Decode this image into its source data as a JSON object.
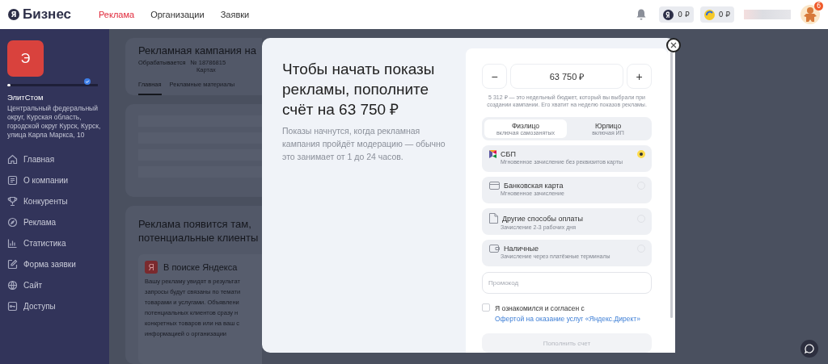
{
  "header": {
    "logo_mark": "Я",
    "logo_text": "Бизнес",
    "nav": [
      {
        "label": "Реклама",
        "selected": true
      },
      {
        "label": "Организации",
        "selected": false
      },
      {
        "label": "Заявки",
        "selected": false
      }
    ],
    "balances": [
      {
        "kind": "ya",
        "amount": "0 ₽"
      },
      {
        "kind": "coin",
        "amount": "0 ₽"
      }
    ],
    "avatar_badge": "6"
  },
  "sidebar": {
    "avatar_letter": "Э",
    "level": 0.02,
    "verified": true,
    "company": "ЭлитСтом",
    "address": "Центральный федеральный округ, Курская область, городской округ Курск, Курск, улица Карла Маркса, 10",
    "items": [
      {
        "kind": "home",
        "label": "Главная"
      },
      {
        "kind": "doc",
        "label": "О компании"
      },
      {
        "kind": "trophy",
        "label": "Конкуренты"
      },
      {
        "kind": "compass",
        "label": "Реклама"
      },
      {
        "kind": "chart",
        "label": "Статистика"
      },
      {
        "kind": "edit",
        "label": "Форма заявки"
      },
      {
        "kind": "globe",
        "label": "Сайт"
      },
      {
        "kind": "key",
        "label": "Доступы"
      }
    ]
  },
  "background": {
    "campaign_title": "Рекламная кампания на",
    "status": "Обрабатывается",
    "number": "№ 18786815",
    "place": "Картах",
    "tabs": [
      {
        "label": "Главная",
        "selected": true
      },
      {
        "label": "Рекламные материалы",
        "selected": false
      }
    ],
    "promo_title": "Реклама появится там, потенциальные клиенты",
    "search_title": "В поиске Яндекса",
    "search_mark": "Я",
    "search_text": [
      "Вашу рекламу увидят в результат",
      "запросы будут связаны по темати",
      "товарами и услугами. Объявлени",
      "потенциальных клиентов сразу н",
      "конкретных товаров или на ваш с",
      "информацией о организации"
    ]
  },
  "modal": {
    "title": "Чтобы начать показы рекламы, пополните счёт на 63 750 ₽",
    "description": "Показы начнутся, когда рекламная кампания пройдёт модерацию — обычно это занимает от 1 до 24 часов.",
    "minus": "−",
    "amount": "63 750 ₽",
    "plus": "+",
    "hint": "5 312 ₽ — это недельный бюджет, который вы выбрали при создании кампании. Его хватит на неделю показов рекламы.",
    "payer_types": [
      {
        "label": "Физлицо",
        "sublabel": "включая самозанятых",
        "selected": true
      },
      {
        "label": "Юрлицо",
        "sublabel": "включая ИП",
        "selected": false
      }
    ],
    "methods": [
      {
        "kind": "sbp",
        "label": "СБП",
        "sublabel": "Мгновенное зачисление без реквизитов карты",
        "selected": true
      },
      {
        "kind": "card",
        "label": "Банковская карта",
        "sublabel": "Мгновенное зачисление",
        "selected": false
      },
      {
        "kind": "other",
        "label": "Другие способы оплаты",
        "sublabel": "Зачисление 2-3 рабочих дня",
        "selected": false
      },
      {
        "kind": "cash",
        "label": "Наличные",
        "sublabel": "Зачисление через платёжные терминалы",
        "selected": false
      }
    ],
    "promo_placeholder": "Промокод",
    "agree_checked": false,
    "agree_text": "Я ознакомился и согласен с",
    "agree_link": "Офертой на оказание услуг «Яндекс.Директ»",
    "submit": "Пополнить счет",
    "submit_disabled": true
  }
}
